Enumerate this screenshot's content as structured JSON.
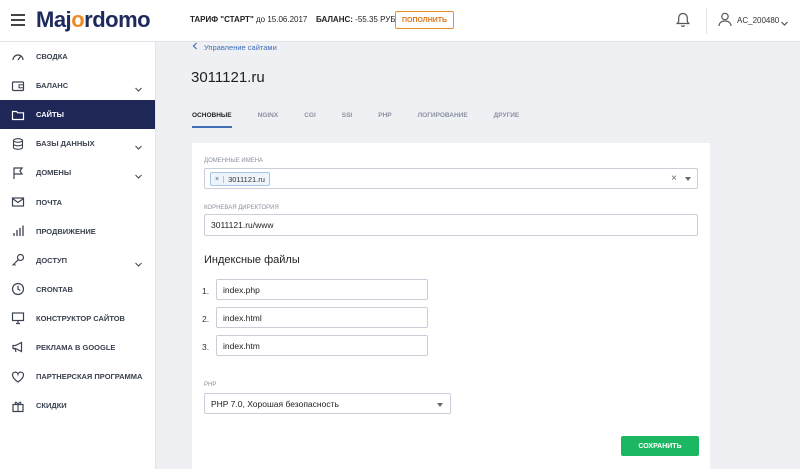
{
  "header": {
    "logo": "Majordomo",
    "tariff_label": "ТАРИФ \"СТАРТ\"",
    "tariff_until": "до 15.06.2017",
    "balance_label": "БАЛАНС:",
    "balance_value": "-55.35 РУБ.",
    "topup_label": "ПОПОЛНИТЬ",
    "account": "AC_200480"
  },
  "sidebar": {
    "items": [
      {
        "label": "СВОДКА"
      },
      {
        "label": "БАЛАНС"
      },
      {
        "label": "САЙТЫ"
      },
      {
        "label": "БАЗЫ ДАННЫХ"
      },
      {
        "label": "ДОМЕНЫ"
      },
      {
        "label": "ПОЧТА"
      },
      {
        "label": "ПРОДВИЖЕНИЕ"
      },
      {
        "label": "ДОСТУП"
      },
      {
        "label": "CRONTAB"
      },
      {
        "label": "КОНСТРУКТОР САЙТОВ"
      },
      {
        "label": "РЕКЛАМА В GOOGLE"
      },
      {
        "label": "ПАРТНЕРСКАЯ ПРОГРАММА"
      },
      {
        "label": "СКИДКИ"
      }
    ]
  },
  "breadcrumb": "Управление сайтами",
  "page_title": "3011121.ru",
  "tabs": [
    "ОСНОВНЫЕ",
    "NGINX",
    "CGI",
    "SSI",
    "PHP",
    "ЛОГИРОВАНИЕ",
    "ДРУГИЕ"
  ],
  "form": {
    "domains_label": "ДОМЕННЫЕ ИМЕНА",
    "domain_tag": "3011121.ru",
    "domain_tag_remove": "×",
    "clear": "×",
    "root_dir_label": "КОРНЕВАЯ ДИРЕКТОРИЯ",
    "root_dir_value": "3011121.ru/www",
    "index_title": "Индексные файлы",
    "index_files": [
      {
        "num": "1.",
        "value": "index.php"
      },
      {
        "num": "2.",
        "value": "index.html"
      },
      {
        "num": "3.",
        "value": "index.htm"
      }
    ],
    "php_label": "PHP",
    "php_value": "PHP 7.0, Хорошая безопасность",
    "save_label": "СОХРАНИТЬ"
  }
}
